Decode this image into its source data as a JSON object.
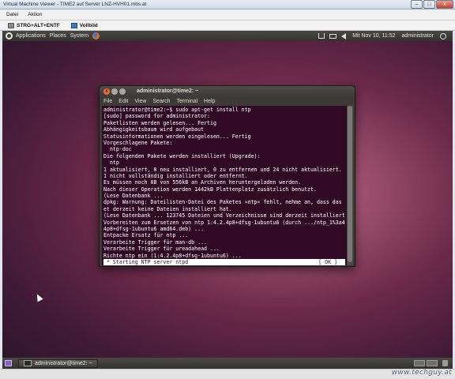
{
  "host": {
    "title": "Virtual Machine Viewer - TIME2 auf Server LNZ-HVH01.mbs.at",
    "window_controls": [
      "–",
      "□",
      "x"
    ],
    "menu": [
      "Datei",
      "Aktion"
    ],
    "toolbar": [
      {
        "label": "STRG+ALT+ENTF",
        "icon": "keyboard-icon"
      },
      {
        "label": "Vollbild",
        "icon": "fullscreen-icon"
      }
    ],
    "watermark": "www.techguy.at"
  },
  "gnome_panel": {
    "menus": [
      "Applications",
      "Places",
      "System"
    ],
    "clock": "Mit Nov 10, 11:52",
    "user": "administrator"
  },
  "terminal": {
    "title": "administrator@time2: ~",
    "titlebar_buttons": [
      "x",
      "–",
      "□"
    ],
    "menu": [
      "File",
      "Edit",
      "View",
      "Search",
      "Terminal",
      "Help"
    ],
    "lines": [
      "administrator@time2:~$ sudo apt-get install ntp",
      "[sudo] password for administrator:",
      "Paketlisten werden gelesen... Fertig",
      "Abhängigkeitsbaum wird aufgebaut",
      "Statusinformationen werden eingelesen... Fertig",
      "Vorgeschlagene Pakete:",
      "  ntp-doc",
      "Die folgenden Pakete werden installiert (Upgrade):",
      "  ntp",
      "1 aktualisiert, 0 neu installiert, 0 zu entfernen und 24 nicht aktualisiert.",
      "1 nicht vollständig installiert oder entfernt.",
      "Es müssen noch 0B von 556kB an Archiven heruntergeladen werden.",
      "Nach dieser Operation werden 1442kB Plattenplatz zusätzlich benutzt.",
      "(Lese Datenbank ...",
      "dpkg: Warnung: Dateilisten-Datei des Paketes »ntp« fehlt, nehme an, dass das Pak",
      "et derzeit keine Dateien installiert hat.",
      "(Lese Datenbank ... 123745 Dateien und Verzeichnisse sind derzeit installiert.)",
      "Vorbereiten zum Ersetzen von ntp 1:4.2.4p8+dfsg-1ubuntu6 (durch .../ntp_1%3a4.2.",
      "4p8+dfsg-1ubuntu6 amd64.deb) ...",
      "Entpacke Ersatz für ntp ...",
      "Verarbeite Trigger für man-db ...",
      "Verarbeite Trigger für ureadahead ...",
      "Richte ntp ein (1:4.2.4p8+dfsg-1ubuntu6) ..."
    ],
    "status_line": " * Starting NTP server ntpd",
    "status_ok": "[ OK ]"
  },
  "bottom_panel": {
    "task_label": "administrator@time2: ~"
  }
}
